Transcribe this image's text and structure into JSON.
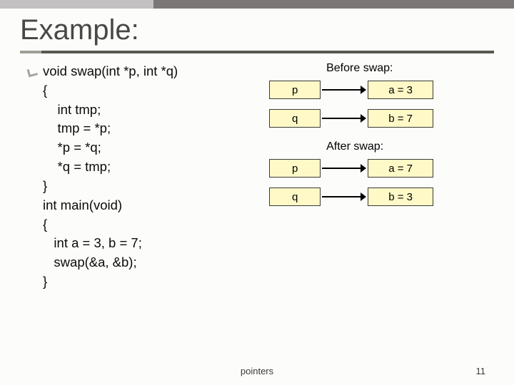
{
  "title": "Example:",
  "code": {
    "l1": "void swap(int *p, int *q)",
    "l2": "{",
    "l3": "    int tmp;",
    "l4": "    tmp = *p;",
    "l5": "    *p = *q;",
    "l6": "    *q = tmp;",
    "l7": "}",
    "l8": "int main(void)",
    "l9": "{",
    "l10": "   int a = 3, b = 7;",
    "l11": "   swap(&a, &b);",
    "l12": "}"
  },
  "diagram": {
    "before_label": "Before swap:",
    "after_label": "After swap:",
    "before": {
      "p_label": "p",
      "p_target": "a = 3",
      "q_label": "q",
      "q_target": "b = 7"
    },
    "after": {
      "p_label": "p",
      "p_target": "a = 7",
      "q_label": "q",
      "q_target": "b = 3"
    }
  },
  "footer": "pointers",
  "page_number": "11"
}
